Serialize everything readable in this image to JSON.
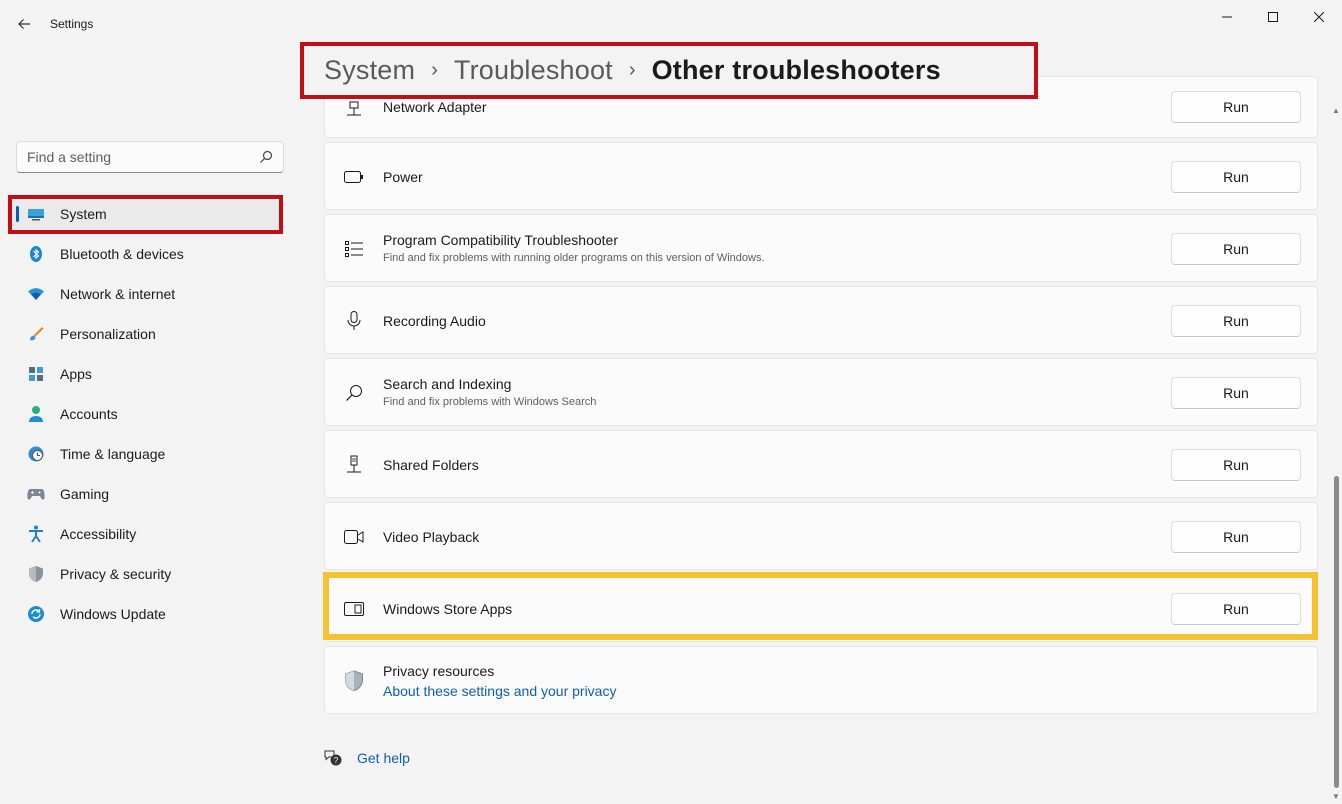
{
  "window": {
    "title": "Settings"
  },
  "breadcrumb": {
    "items": [
      "System",
      "Troubleshoot",
      "Other troubleshooters"
    ],
    "separator": "›"
  },
  "search": {
    "placeholder": "Find a setting",
    "value": ""
  },
  "sidebar": {
    "items": [
      {
        "label": "System",
        "icon": "system-icon",
        "selected": true
      },
      {
        "label": "Bluetooth & devices",
        "icon": "bluetooth-icon"
      },
      {
        "label": "Network & internet",
        "icon": "wifi-icon"
      },
      {
        "label": "Personalization",
        "icon": "brush-icon"
      },
      {
        "label": "Apps",
        "icon": "apps-icon"
      },
      {
        "label": "Accounts",
        "icon": "account-icon"
      },
      {
        "label": "Time & language",
        "icon": "clock-globe-icon"
      },
      {
        "label": "Gaming",
        "icon": "gamepad-icon"
      },
      {
        "label": "Accessibility",
        "icon": "accessibility-icon"
      },
      {
        "label": "Privacy & security",
        "icon": "shield-icon"
      },
      {
        "label": "Windows Update",
        "icon": "update-icon"
      }
    ]
  },
  "troubleshooters": [
    {
      "title": "Network Adapter",
      "desc": "",
      "icon": "network-adapter-icon",
      "button": "Run"
    },
    {
      "title": "Power",
      "desc": "",
      "icon": "battery-icon",
      "button": "Run"
    },
    {
      "title": "Program Compatibility Troubleshooter",
      "desc": "Find and fix problems with running older programs on this version of Windows.",
      "icon": "list-icon",
      "button": "Run"
    },
    {
      "title": "Recording Audio",
      "desc": "",
      "icon": "microphone-icon",
      "button": "Run"
    },
    {
      "title": "Search and Indexing",
      "desc": "Find and fix problems with Windows Search",
      "icon": "search-icon",
      "button": "Run"
    },
    {
      "title": "Shared Folders",
      "desc": "",
      "icon": "shared-folders-icon",
      "button": "Run"
    },
    {
      "title": "Video Playback",
      "desc": "",
      "icon": "video-camera-icon",
      "button": "Run"
    },
    {
      "title": "Windows Store Apps",
      "desc": "",
      "icon": "store-app-icon",
      "button": "Run"
    }
  ],
  "privacy": {
    "title": "Privacy resources",
    "link": "About these settings and your privacy"
  },
  "help": {
    "label": "Get help"
  },
  "colors": {
    "accent": "#005fb8",
    "annotation_red": "#c00f16",
    "annotation_yellow": "#f7c231",
    "link": "#0f5fb5"
  }
}
